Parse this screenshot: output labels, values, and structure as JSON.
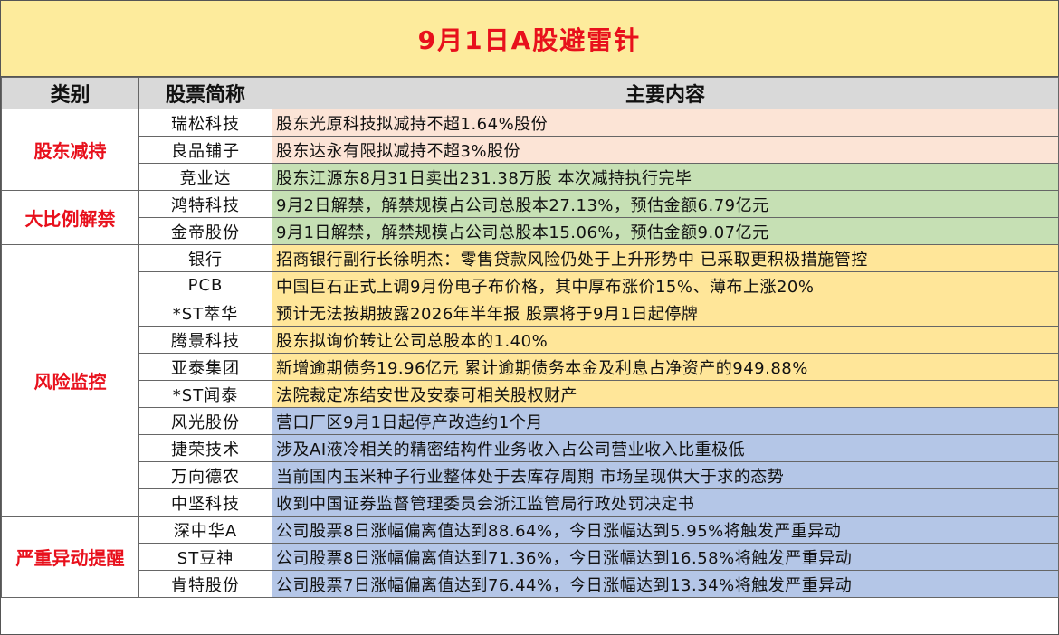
{
  "title": "9月1日A股避雷针",
  "headers": {
    "category": "类别",
    "stock": "股票简称",
    "content": "主要内容"
  },
  "categories": [
    {
      "label": "股东减持",
      "rows": [
        {
          "stock": "瑞松科技",
          "content": "股东光原科技拟减持不超1.64%股份",
          "color": "#fce4d6"
        },
        {
          "stock": "良品铺子",
          "content": "股东达永有限拟减持不超3%股份",
          "color": "#fce4d6"
        },
        {
          "stock": "竞业达",
          "content": "股东江源东8月31日卖出231.38万股 本次减持执行完毕",
          "color": "#c6e0b4"
        }
      ]
    },
    {
      "label": "大比例解禁",
      "rows": [
        {
          "stock": "鸿特科技",
          "content": "9月2日解禁，解禁规模占公司总股本27.13%，预估金额6.79亿元",
          "color": "#c6e0b4"
        },
        {
          "stock": "金帝股份",
          "content": "9月1日解禁，解禁规模占公司总股本15.06%，预估金额9.07亿元",
          "color": "#c6e0b4"
        }
      ]
    },
    {
      "label": "风险监控",
      "rows": [
        {
          "stock": "银行",
          "content": "招商银行副行长徐明杰：零售贷款风险仍处于上升形势中 已采取更积极措施管控",
          "color": "#ffe699"
        },
        {
          "stock": "PCB",
          "content": "中国巨石正式上调9月份电子布价格，其中厚布涨价15%、薄布上涨20%",
          "color": "#ffe699"
        },
        {
          "stock": "*ST萃华",
          "content": "预计无法按期披露2026年半年报 股票将于9月1日起停牌",
          "color": "#ffe699"
        },
        {
          "stock": "腾景科技",
          "content": "股东拟询价转让公司总股本的1.40%",
          "color": "#ffe699"
        },
        {
          "stock": "亚泰集团",
          "content": "新增逾期债务19.96亿元 累计逾期债务本金及利息占净资产的949.88%",
          "color": "#ffe699"
        },
        {
          "stock": "*ST闻泰",
          "content": "法院裁定冻结安世及安泰可相关股权财产",
          "color": "#ffe699"
        },
        {
          "stock": "风光股份",
          "content": "营口厂区9月1日起停产改造约1个月",
          "color": "#b4c6e7"
        },
        {
          "stock": "捷荣技术",
          "content": "涉及AI液冷相关的精密结构件业务收入占公司营业收入比重极低",
          "color": "#b4c6e7"
        },
        {
          "stock": "万向德农",
          "content": "当前国内玉米种子行业整体处于去库存周期 市场呈现供大于求的态势",
          "color": "#b4c6e7"
        },
        {
          "stock": "中坚科技",
          "content": "收到中国证券监督管理委员会浙江监管局行政处罚决定书",
          "color": "#b4c6e7"
        }
      ]
    },
    {
      "label": "严重异动提醒",
      "rows": [
        {
          "stock": "深中华A",
          "content": "公司股票8日涨幅偏离值达到88.64%，今日涨幅达到5.95%将触发严重异动",
          "color": "#b4c6e7"
        },
        {
          "stock": "ST豆神",
          "content": "公司股票8日涨幅偏离值达到71.36%，今日涨幅达到16.58%将触发严重异动",
          "color": "#b4c6e7"
        },
        {
          "stock": "肯特股份",
          "content": "公司股票7日涨幅偏离值达到76.44%，今日涨幅达到13.34%将触发严重异动",
          "color": "#b4c6e7"
        }
      ]
    }
  ]
}
